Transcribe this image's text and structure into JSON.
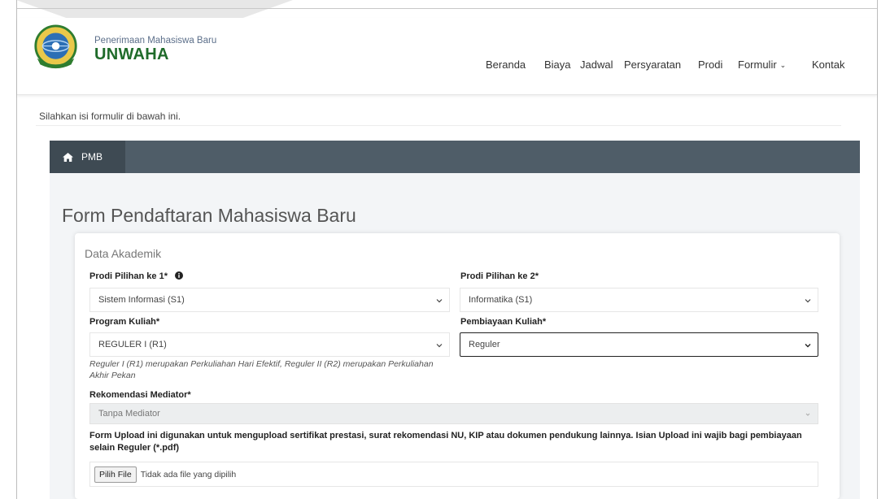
{
  "brand": {
    "subtitle": "Penerimaan Mahasiswa Baru",
    "name": "UNWAHA",
    "logo_icon": "university-crest-icon"
  },
  "nav": {
    "items": [
      {
        "label": "Beranda"
      },
      {
        "label": "Biaya"
      },
      {
        "label": "Jadwal"
      },
      {
        "label": "Persyaratan"
      },
      {
        "label": "Prodi"
      },
      {
        "label": "Formulir",
        "has_dropdown": true
      },
      {
        "label": "Kontak"
      }
    ]
  },
  "intro_text": "Silahkan isi formulir di bawah ini.",
  "breadcrumb": {
    "label": "PMB",
    "icon": "home-icon"
  },
  "page_title": "Form Pendaftaran Mahasiswa Baru",
  "section_title": "Data Akademik",
  "form": {
    "prodi1": {
      "label": "Prodi Pilihan ke 1*",
      "value": "Sistem Informasi (S1)",
      "info_icon": "info-circle-icon"
    },
    "prodi2": {
      "label": "Prodi Pilihan ke 2*",
      "value": "Informatika (S1)"
    },
    "program": {
      "label": "Program Kuliah*",
      "value": "REGULER I (R1)"
    },
    "pembiayaan": {
      "label": "Pembiayaan Kuliah*",
      "value": "Reguler"
    },
    "program_help": "Reguler I (R1) merupakan Perkuliahan Hari Efektif, Reguler II (R2) merupakan Perkuliahan Akhir Pekan",
    "mediator": {
      "label": "Rekomendasi Mediator*",
      "value": "Tanpa Mediator"
    },
    "upload_note": "Form Upload ini digunakan untuk mengupload sertifikat prestasi, surat rekomendasi NU, KIP atau dokumen pendukung lainnya. Isian Upload ini wajib bagi pembiayaan selain Reguler (*.pdf)",
    "file": {
      "button": "Pilih File",
      "status": "Tidak ada file yang dipilih"
    }
  },
  "colors": {
    "brand_green": "#1f6b2a",
    "breadcrumb_bar": "#4f5d68",
    "breadcrumb_active": "#3e4a53",
    "content_bg": "#f3f5f7"
  }
}
